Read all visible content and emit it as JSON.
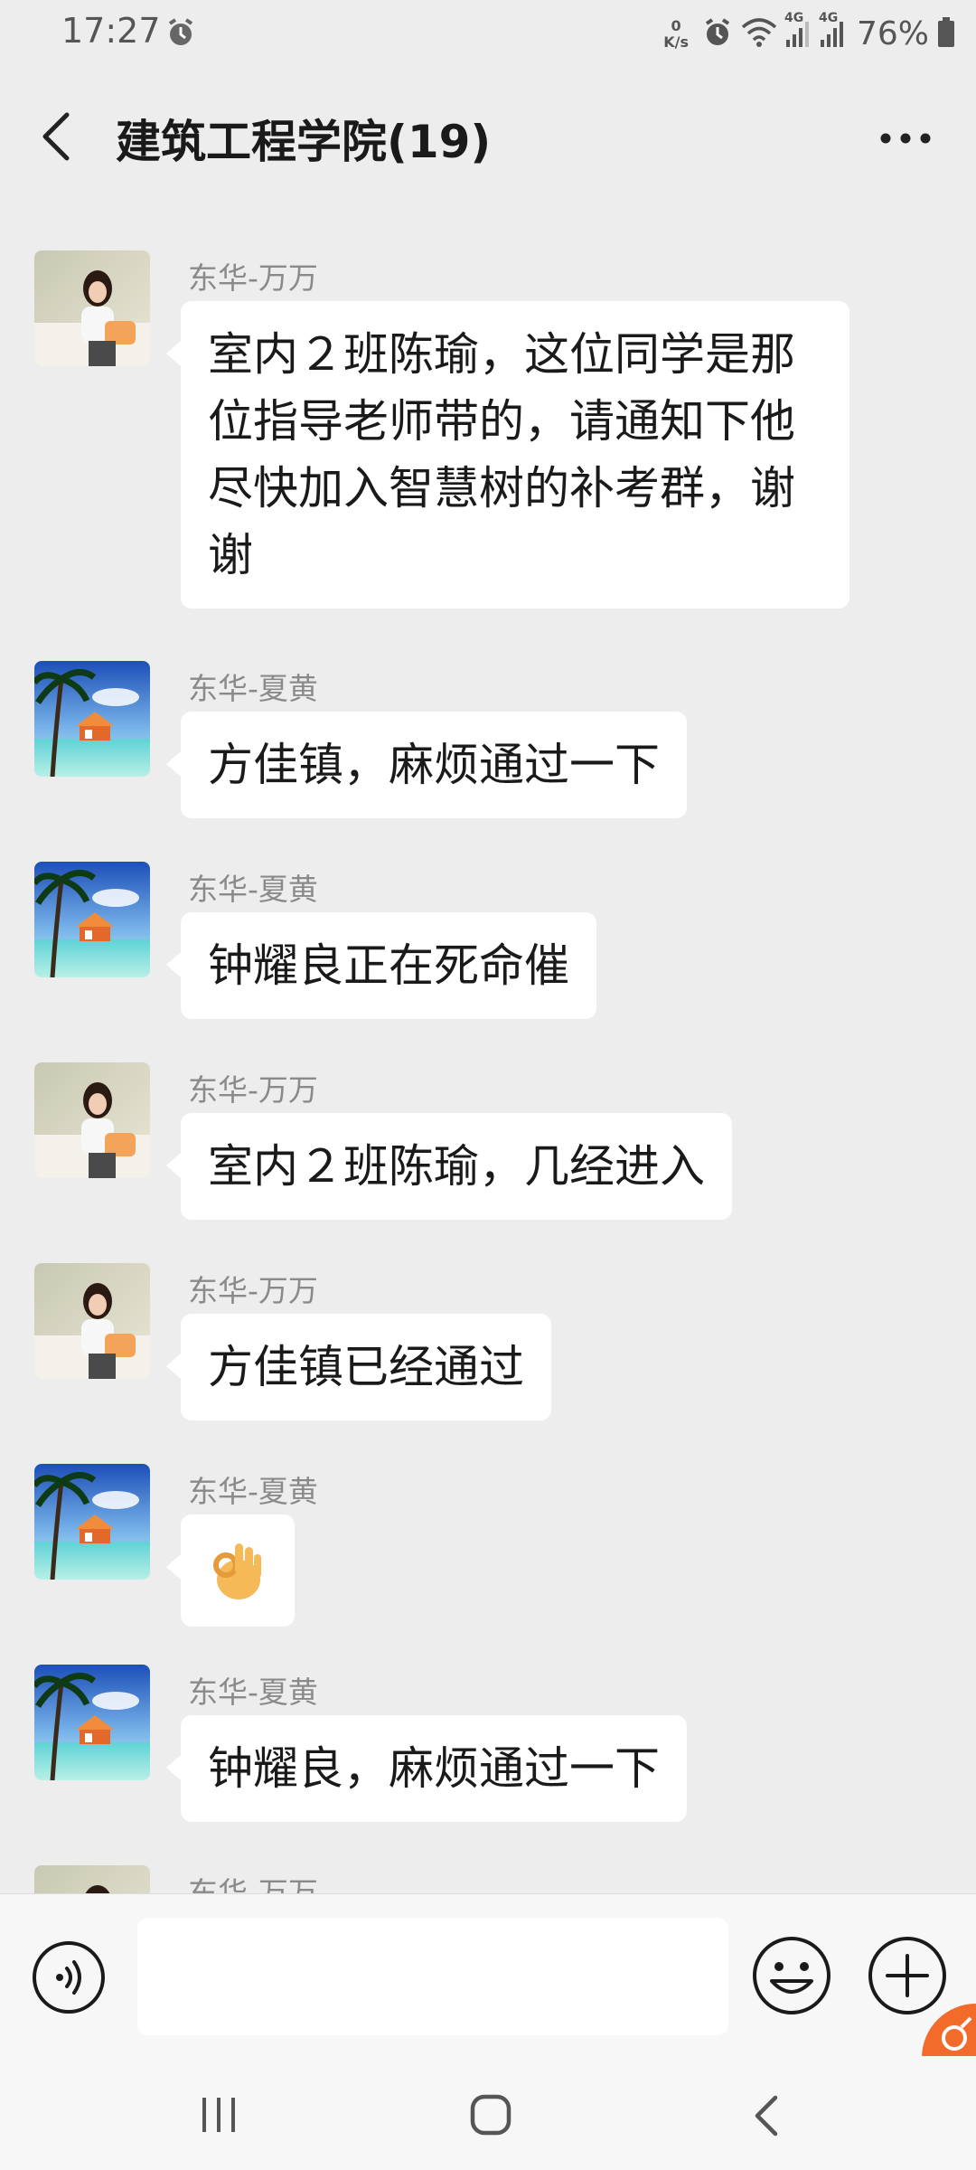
{
  "status_bar": {
    "time": "17:27",
    "net_speed_value": "0",
    "net_speed_unit": "K/s",
    "network_1": "4G",
    "network_2": "4G",
    "battery": "76%"
  },
  "header": {
    "title": "建筑工程学院(19)",
    "back_icon": "chevron-left-icon",
    "more_icon": "ellipsis-icon"
  },
  "messages": [
    {
      "sender": "东华-万万",
      "avatar": "girl-photo",
      "text": "室内２班陈瑜，这位同学是那位指导老师带的，请通知下他尽快加入智慧树的补考群，谢谢"
    },
    {
      "sender": "东华-夏黄",
      "avatar": "beach-photo",
      "text": "方佳镇，麻烦通过一下"
    },
    {
      "sender": "东华-夏黄",
      "avatar": "beach-photo",
      "text": "钟耀良正在死命催"
    },
    {
      "sender": "东华-万万",
      "avatar": "girl-photo",
      "text": "室内２班陈瑜，几经进入"
    },
    {
      "sender": "东华-万万",
      "avatar": "girl-photo",
      "text": "方佳镇已经通过"
    },
    {
      "sender": "东华-夏黄",
      "avatar": "beach-photo",
      "text": "",
      "emoji": "ok-hand-emoji"
    },
    {
      "sender": "东华-夏黄",
      "avatar": "beach-photo",
      "text": "钟耀良，麻烦通过一下"
    },
    {
      "sender": "东华-万万",
      "avatar": "girl-photo",
      "text": ""
    }
  ],
  "input_bar": {
    "voice_icon": "voice-icon",
    "emoji_icon": "smiley-icon",
    "plus_icon": "plus-circle-icon",
    "value": ""
  },
  "colors": {
    "background": "#ededed",
    "bubble": "#ffffff",
    "sender": "#8a8a8a",
    "badge": "#f26b2a"
  }
}
